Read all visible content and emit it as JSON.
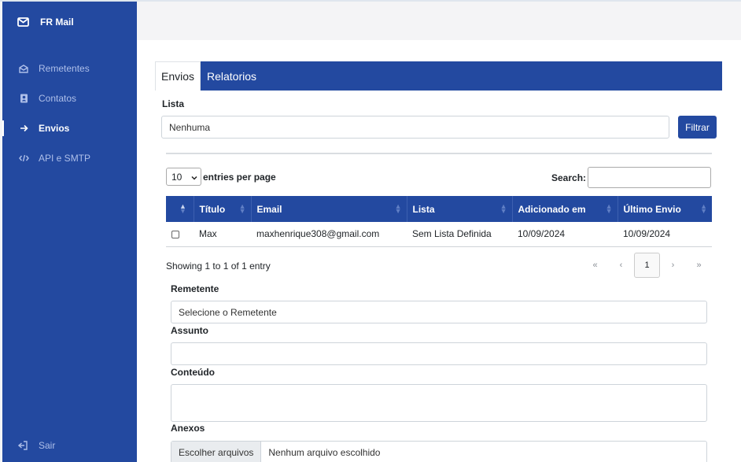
{
  "sidebar": {
    "brand": "FR Mail",
    "items": [
      {
        "label": "Remetentes",
        "icon": "envelope-open-icon"
      },
      {
        "label": "Contatos",
        "icon": "address-book-icon"
      },
      {
        "label": "Envios",
        "icon": "arrow-right-icon",
        "active": true
      },
      {
        "label": "API e SMTP",
        "icon": "code-icon"
      }
    ],
    "logout": "Sair"
  },
  "tabs": [
    {
      "label": "Envios",
      "active": true
    },
    {
      "label": "Relatorios"
    }
  ],
  "filter": {
    "label": "Lista",
    "value": "Nenhuma",
    "button": "Filtrar"
  },
  "datatable": {
    "per_page": "10",
    "per_page_label": "entries per page",
    "search_label": "Search:",
    "columns": [
      "Título",
      "Email",
      "Lista",
      "Adicionado em",
      "Último Envio"
    ],
    "rows": [
      {
        "titulo": "Max",
        "email": "maxhenrique308@gmail.com",
        "lista": "Sem Lista Definida",
        "adicionado": "10/09/2024",
        "ultimo": "10/09/2024"
      }
    ],
    "info": "Showing 1 to 1 of 1 entry",
    "pager": {
      "first": "«",
      "prev": "‹",
      "current": "1",
      "next": "›",
      "last": "»"
    }
  },
  "form": {
    "remetente_label": "Remetente",
    "remetente_value": "Selecione o Remetente",
    "assunto_label": "Assunto",
    "assunto_value": "",
    "conteudo_label": "Conteúdo",
    "conteudo_value": "",
    "anexos_label": "Anexos",
    "file_button": "Escolher arquivos",
    "file_status": "Nenhum arquivo escolhido"
  },
  "colors": {
    "primary": "#2349a0",
    "sidebar_text": "#aebfe9",
    "background": "#f4f5f7"
  }
}
